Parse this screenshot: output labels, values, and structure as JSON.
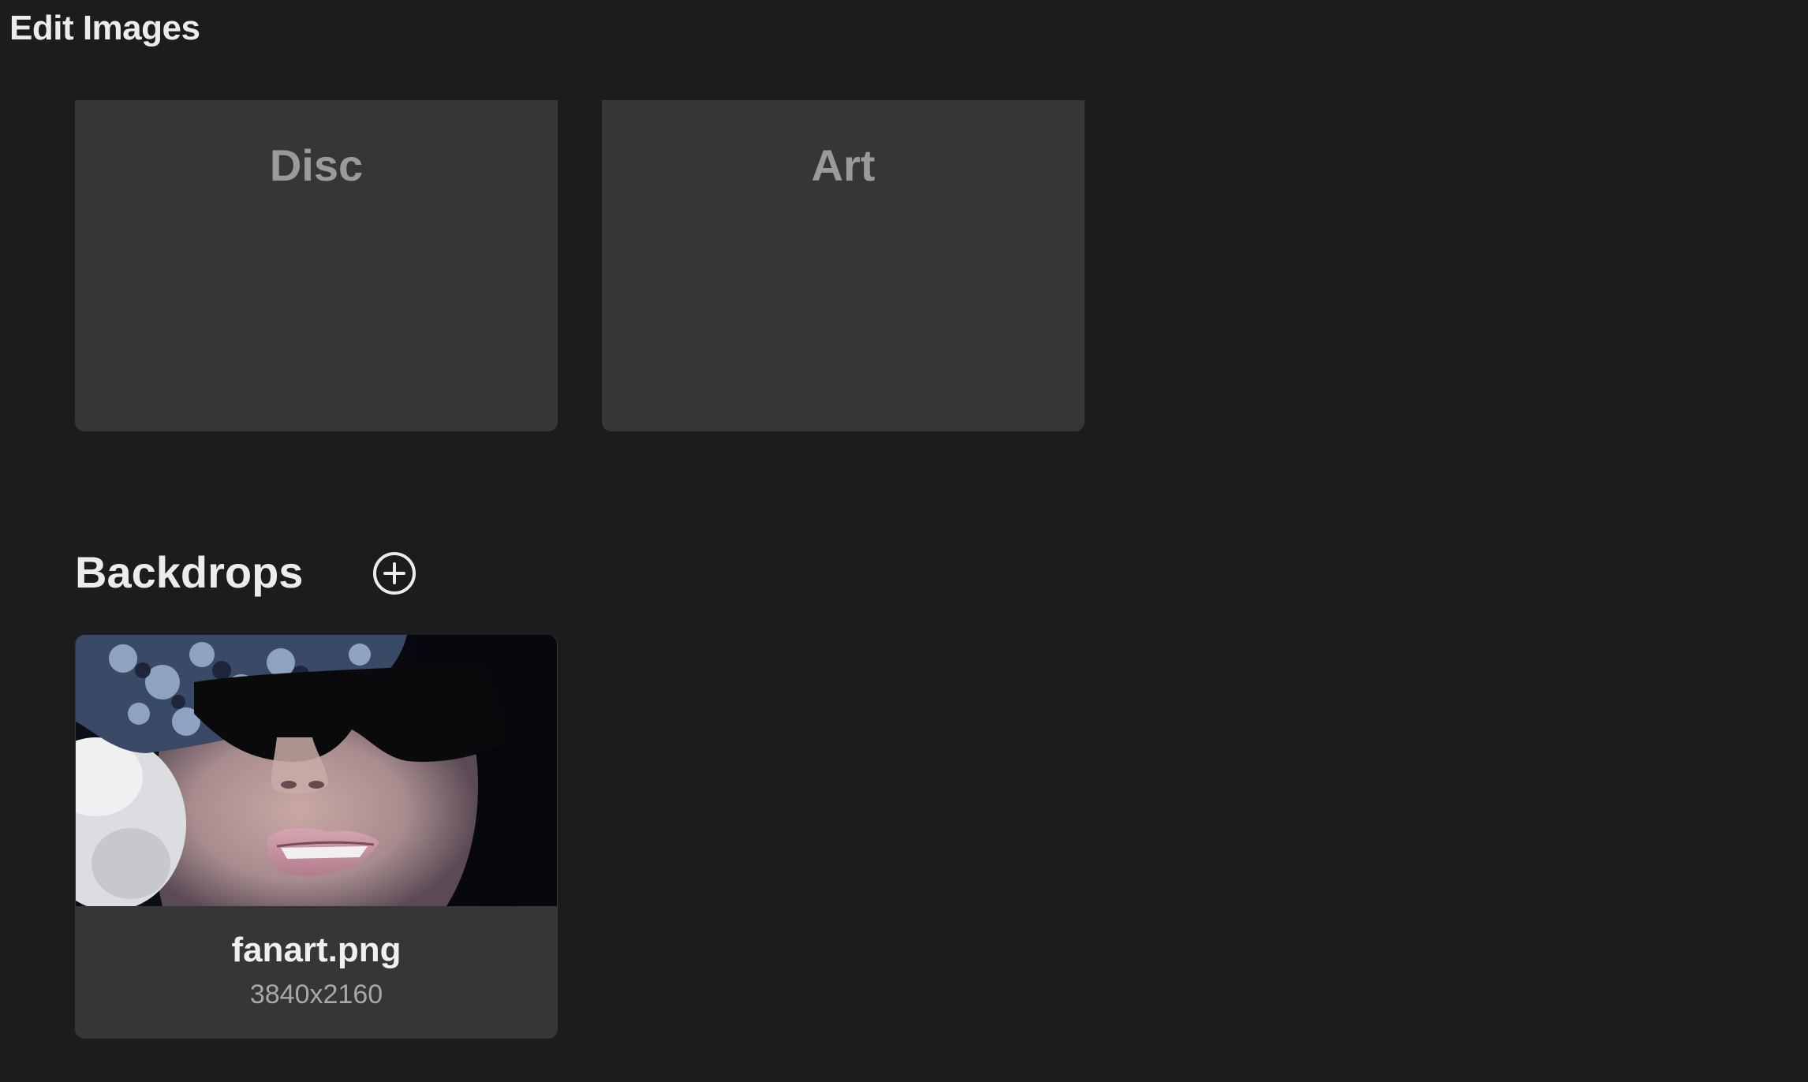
{
  "page": {
    "title": "Edit Images"
  },
  "image_slots": [
    {
      "label": "Disc"
    },
    {
      "label": "Art"
    }
  ],
  "backdrops": {
    "title": "Backdrops",
    "add_icon": "plus-circle-icon",
    "items": [
      {
        "name": "fanart.png",
        "dimensions": "3840x2160"
      }
    ]
  },
  "colors": {
    "background": "#1c1c1e",
    "card": "#363638",
    "label_muted": "#9a9a9c",
    "text_primary": "#ececec"
  }
}
